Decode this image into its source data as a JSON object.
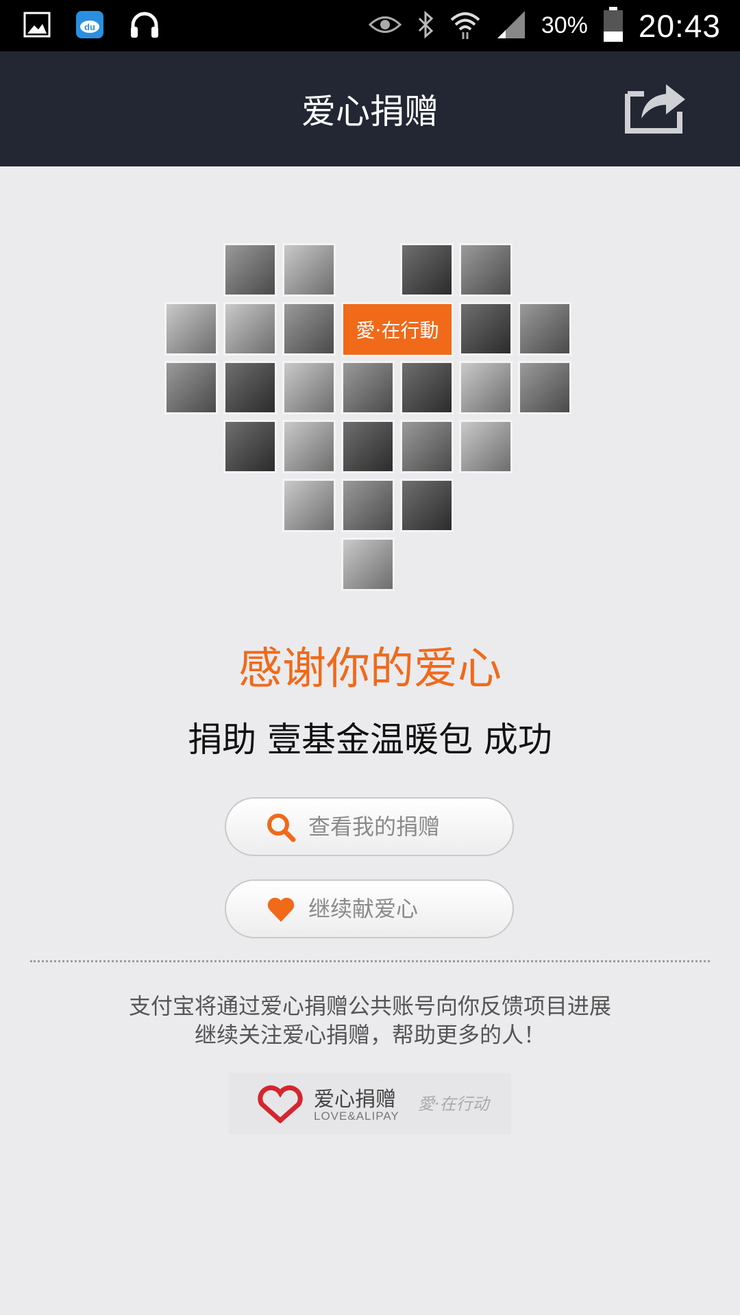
{
  "status_bar": {
    "battery_percent": "30%",
    "time": "20:43"
  },
  "header": {
    "title": "爱心捐赠"
  },
  "hero": {
    "badge_text": "愛·在行動"
  },
  "main": {
    "thanks_text": "感谢你的爱心",
    "success_text": "捐助 壹基金温暖包 成功"
  },
  "actions": {
    "view_donations_label": "查看我的捐赠",
    "continue_donating_label": "继续献爱心"
  },
  "footer": {
    "info_line1": "支付宝将通过爱心捐赠公共账号向你反馈项目进展",
    "info_line2": "继续关注爱心捐赠，帮助更多的人！",
    "brand_name": "爱心捐赠",
    "brand_sub": "LOVE&ALIPAY",
    "brand_slogan": "愛·在行动"
  },
  "colors": {
    "accent": "#f06a1a",
    "header_bg": "#222733",
    "page_bg": "#ebebee"
  },
  "icons": {
    "status_left": [
      "gallery-icon",
      "baidu-cloud-icon",
      "headphones-icon"
    ],
    "status_right": [
      "eye-icon",
      "bluetooth-icon",
      "wifi-icon",
      "signal-icon",
      "battery-icon"
    ],
    "header": "share-icon",
    "view_donations": "search-icon",
    "continue_donating": "heart-icon"
  }
}
